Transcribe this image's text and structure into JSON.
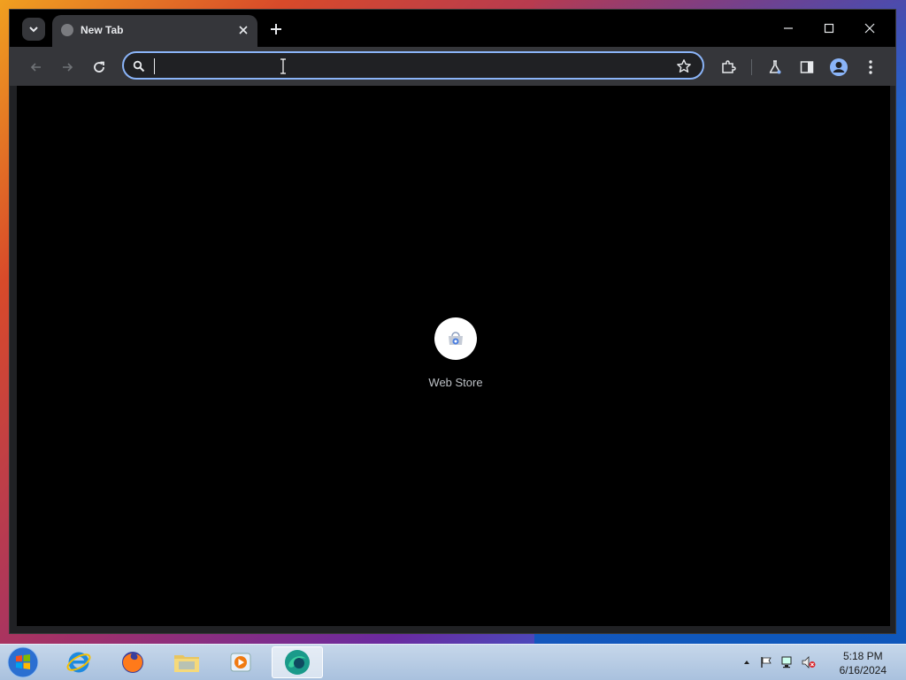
{
  "browser": {
    "tab": {
      "title": "New Tab"
    },
    "omnibox": {
      "value": "",
      "placeholder": ""
    },
    "accent_color": "#8ab4f8"
  },
  "new_tab_page": {
    "shortcuts": [
      {
        "label": "Web Store",
        "icon": "web-store-icon"
      }
    ]
  },
  "taskbar": {
    "apps": [
      {
        "name": "internet-explorer",
        "icon": "ie-icon"
      },
      {
        "name": "firefox",
        "icon": "firefox-icon"
      },
      {
        "name": "file-explorer",
        "icon": "folder-icon"
      },
      {
        "name": "media-player",
        "icon": "media-player-icon"
      },
      {
        "name": "browser",
        "icon": "browser-icon",
        "active": true
      }
    ],
    "clock": {
      "time": "5:18 PM",
      "date": "6/16/2024"
    }
  }
}
